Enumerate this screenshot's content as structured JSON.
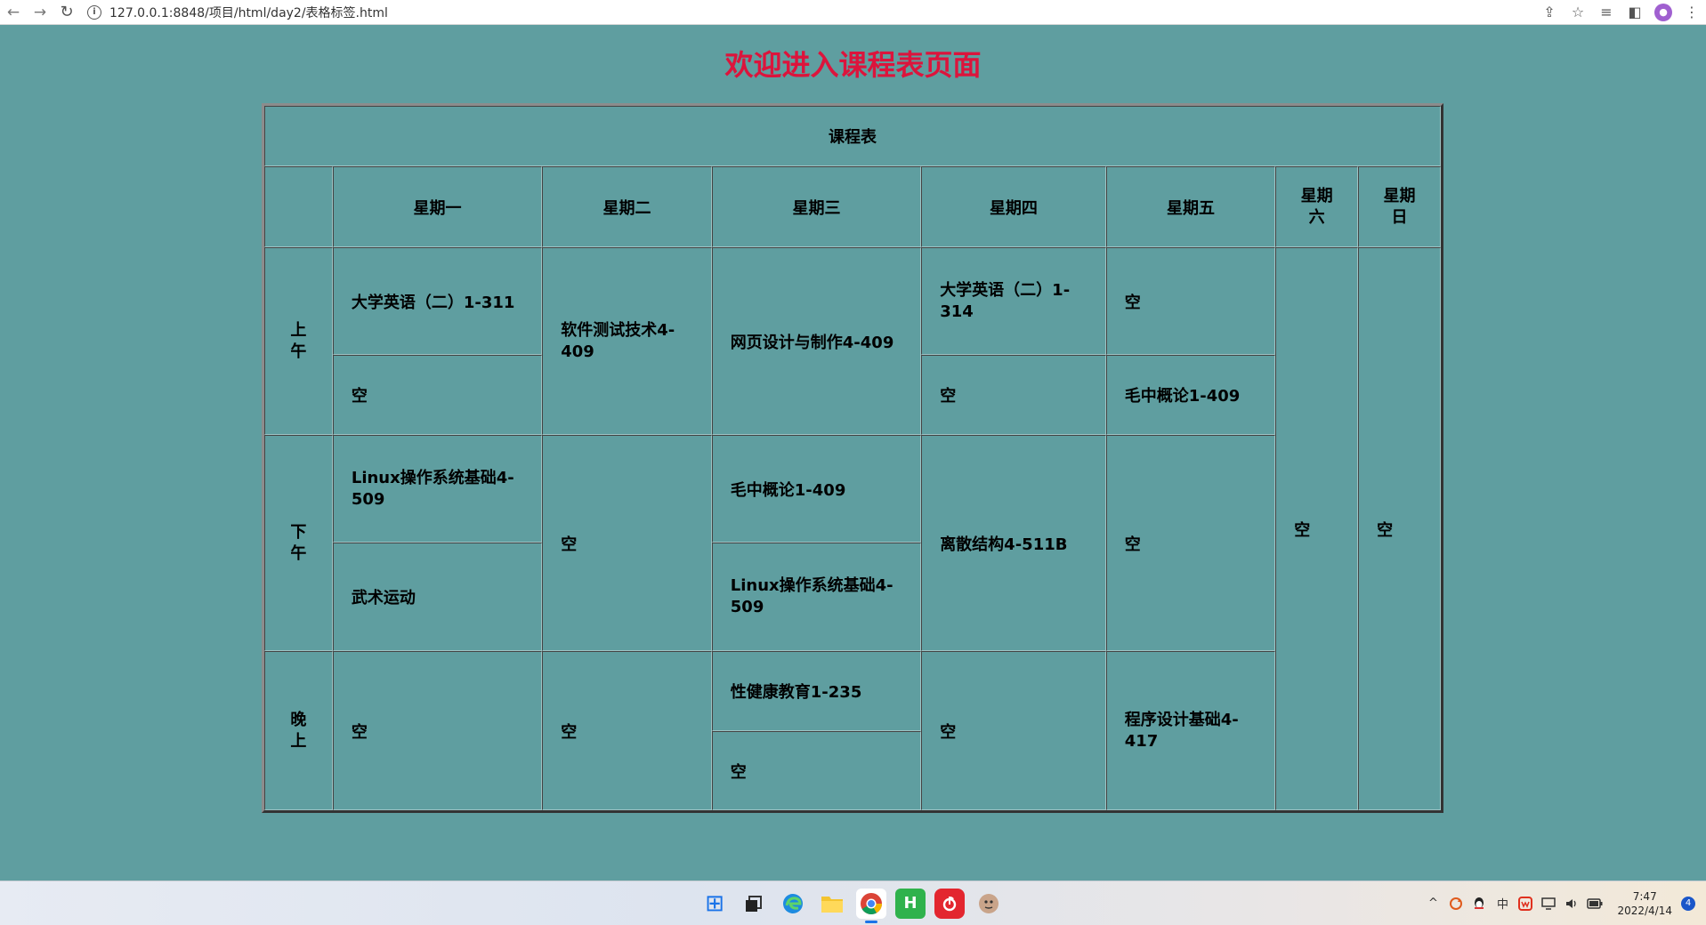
{
  "browser": {
    "url": "127.0.0.1:8848/项目/html/day2/表格标签.html",
    "back_icon": "←",
    "forward_icon": "→",
    "reload_icon": "↻",
    "info_icon": "i",
    "toolbar_icons": [
      "share-icon",
      "star-icon",
      "reading-list-icon",
      "sidebar-icon"
    ],
    "share_glyph": "⇪",
    "star_glyph": "☆",
    "reading_glyph": "≡",
    "sidebar_glyph": "◧",
    "avatar_glyph": "●",
    "menu_glyph": "⋮"
  },
  "page": {
    "title": "欢迎进入课程表页面"
  },
  "table": {
    "caption": "课程表",
    "days": [
      "星期一",
      "星期二",
      "星期三",
      "星期四",
      "星期五"
    ],
    "saturday": [
      "星期",
      "六"
    ],
    "sunday": [
      "星期",
      "日"
    ],
    "periods": {
      "morning": [
        "上",
        "午"
      ],
      "afternoon": [
        "下",
        "午"
      ],
      "evening": [
        "晚",
        "上"
      ]
    },
    "cells": {
      "mon_am1": "大学英语（二）1-311",
      "mon_am2": "空",
      "mon_pm1": [
        "Linux操作系统基础4-",
        "509"
      ],
      "mon_pm2": "武术运动",
      "mon_eve": "空",
      "tue_am": [
        "软件测试技术4-",
        "409"
      ],
      "tue_pm": "空",
      "tue_eve": "空",
      "wed_am": "网页设计与制作4-409",
      "wed_pm1": "毛中概论1-409",
      "wed_pm2": [
        "Linux操作系统基础4-",
        "509"
      ],
      "wed_eve1": "性健康教育1-235",
      "wed_eve2": "空",
      "thu_am1": [
        "大学英语（二）1-",
        "314"
      ],
      "thu_am2": "空",
      "thu_pm": "离散结构4-511B",
      "thu_eve": "空",
      "fri_am1": "空",
      "fri_am2": "毛中概论1-409",
      "fri_pm": "空",
      "fri_eve": [
        "程序设计基础4-",
        "417"
      ],
      "sat": "空",
      "sun": "空"
    }
  },
  "taskbar": {
    "apps": [
      "start-icon",
      "task-view-icon",
      "edge-icon",
      "file-explorer-icon",
      "chrome-icon",
      "hbuilder-icon",
      "netease-music-icon",
      "user-app-icon"
    ],
    "hbuilder_glyph": "H",
    "start_glyph": "⊞",
    "tray_chevron": "^",
    "ime": "中",
    "clock_time": "7:47",
    "clock_date": "2022/4/14",
    "notification_count": "4"
  }
}
